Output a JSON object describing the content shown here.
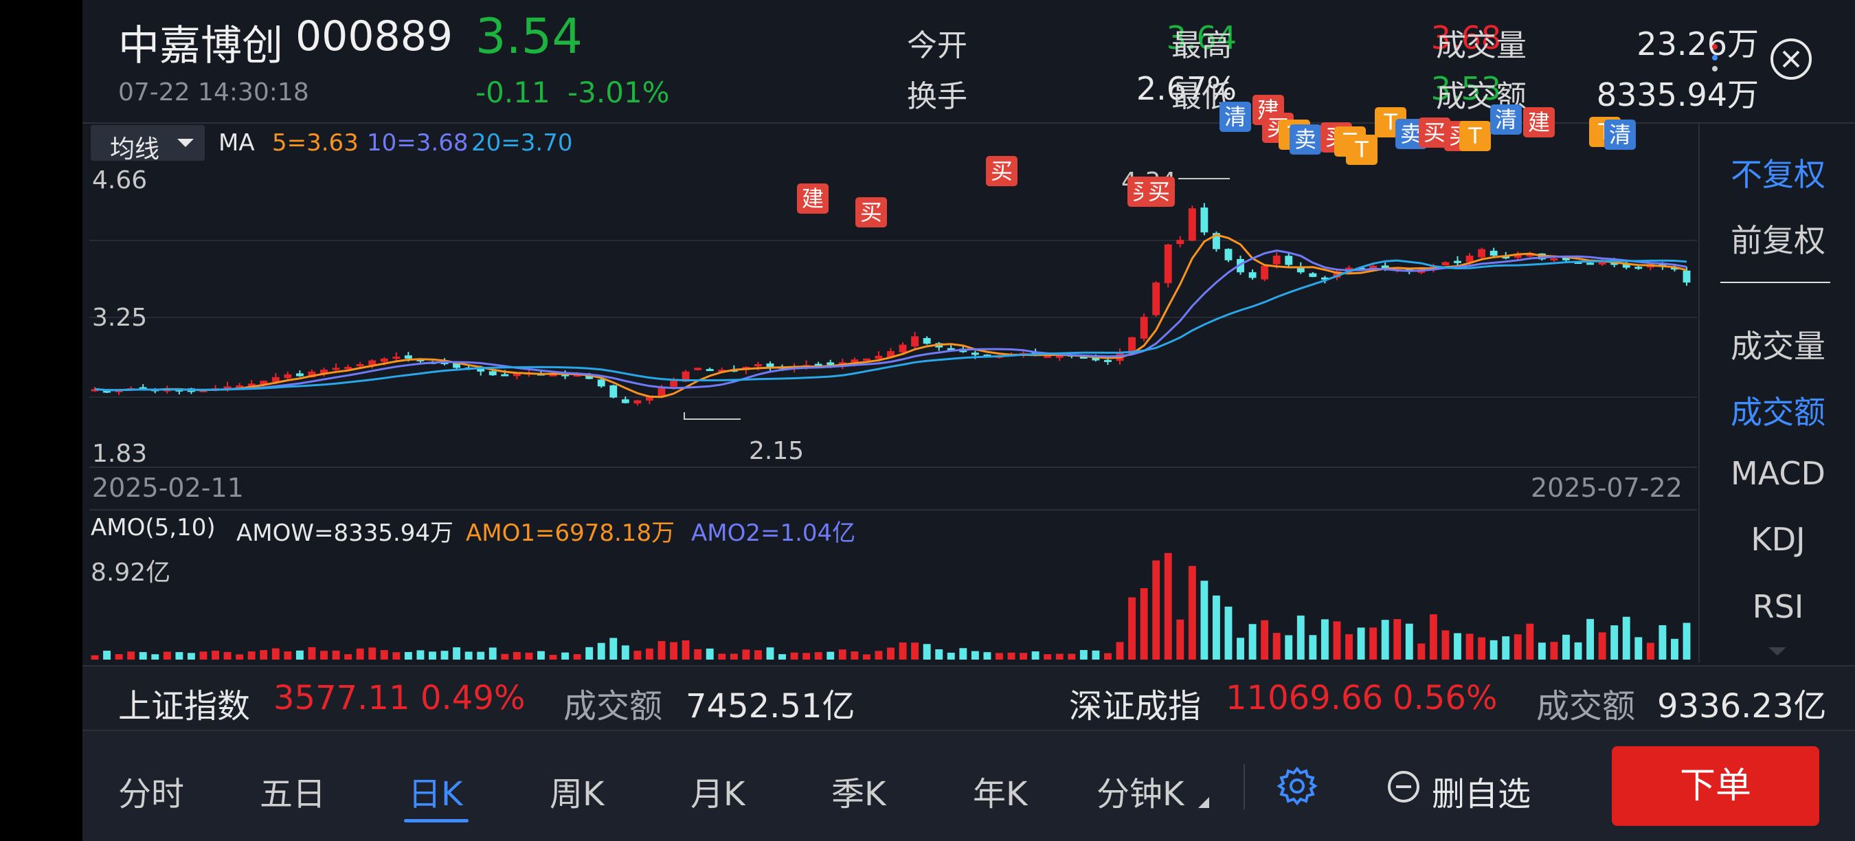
{
  "stock": {
    "name": "中嘉博创",
    "code": "000889",
    "price": "3.54",
    "datetime": "07-22 14:30:18",
    "change": "-0.11",
    "change_pct": "-3.01%"
  },
  "stats": {
    "open_label": "今开",
    "open": "3.64",
    "high_label": "最高",
    "high": "3.68",
    "volume_label": "成交量",
    "volume": "23.26万",
    "turnover_label": "换手",
    "turnover": "2.67%",
    "low_label": "最低",
    "low": "3.53",
    "amount_label": "成交额",
    "amount": "8335.94万"
  },
  "ma_legend": {
    "selector": "均线",
    "prefix": "MA",
    "ma5": "5=3.63",
    "ma10": "10=3.68",
    "ma20": "20=3.70"
  },
  "price_axis": {
    "top": "4.66",
    "mid": "3.25",
    "bottom": "1.83"
  },
  "annotations": {
    "high": "4.34",
    "low": "2.15"
  },
  "dates": {
    "start": "2025-02-11",
    "end": "2025-07-22"
  },
  "amo_legend": {
    "title": "AMO(5,10)",
    "amow": "AMOW=8335.94万",
    "amo1": "AMO1=6978.18万",
    "amo2": "AMO2=1.04亿"
  },
  "amo_axis": {
    "top": "8.92亿"
  },
  "markers": [
    {
      "text": "建",
      "kind": "red"
    },
    {
      "text": "买",
      "kind": "red"
    },
    {
      "text": "买",
      "kind": "red"
    },
    {
      "text": "买",
      "kind": "red"
    },
    {
      "text": "买",
      "kind": "red"
    },
    {
      "text": "清",
      "kind": "blue"
    },
    {
      "text": "建",
      "kind": "red"
    },
    {
      "text": "买",
      "kind": "red"
    },
    {
      "text": "T",
      "kind": "orange"
    },
    {
      "text": "卖",
      "kind": "blue"
    },
    {
      "text": "买",
      "kind": "red"
    },
    {
      "text": "T",
      "kind": "orange"
    },
    {
      "text": "T",
      "kind": "orange"
    },
    {
      "text": "T",
      "kind": "orange"
    },
    {
      "text": "卖",
      "kind": "blue"
    },
    {
      "text": "买",
      "kind": "red"
    },
    {
      "text": "买",
      "kind": "red"
    },
    {
      "text": "T",
      "kind": "orange"
    },
    {
      "text": "清",
      "kind": "blue"
    },
    {
      "text": "建",
      "kind": "red"
    },
    {
      "text": "T",
      "kind": "orange"
    },
    {
      "text": "清",
      "kind": "blue"
    }
  ],
  "right_panel": {
    "items": [
      "不复权",
      "前复权",
      "成交量",
      "成交额",
      "MACD",
      "KDJ",
      "RSI"
    ]
  },
  "index_bar": {
    "sh_name": "上证指数",
    "sh_value": "3577.11",
    "sh_pct": "0.49%",
    "sh_amount_label": "成交额",
    "sh_amount": "7452.51亿",
    "sz_name": "深证成指",
    "sz_value": "11069.66",
    "sz_pct": "0.56%",
    "sz_amount_label": "成交额",
    "sz_amount": "9336.23亿"
  },
  "tabs": [
    "分时",
    "五日",
    "日K",
    "周K",
    "月K",
    "季K",
    "年K",
    "分钟K"
  ],
  "active_tab": "日K",
  "actions": {
    "remove_watch": "删自选",
    "order": "下单"
  },
  "colors": {
    "up": "#e8242b",
    "down": "#1cb33f",
    "accent": "#3f8cff",
    "ma5": "#f7931e",
    "ma10": "#6f7bf7",
    "ma20": "#2aa7e8"
  },
  "chart_data": {
    "type": "candlestick",
    "x_range": [
      "2025-02-11",
      "2025-07-22"
    ],
    "ylim": [
      1.83,
      4.66
    ],
    "close": [
      2.39,
      2.37,
      2.38,
      2.4,
      2.39,
      2.38,
      2.4,
      2.38,
      2.36,
      2.38,
      2.4,
      2.42,
      2.43,
      2.45,
      2.48,
      2.52,
      2.55,
      2.53,
      2.58,
      2.6,
      2.62,
      2.63,
      2.66,
      2.7,
      2.72,
      2.74,
      2.72,
      2.69,
      2.68,
      2.66,
      2.62,
      2.6,
      2.58,
      2.54,
      2.55,
      2.56,
      2.57,
      2.55,
      2.55,
      2.54,
      2.55,
      2.5,
      2.42,
      2.3,
      2.24,
      2.27,
      2.32,
      2.4,
      2.48,
      2.58,
      2.62,
      2.59,
      2.6,
      2.6,
      2.63,
      2.66,
      2.62,
      2.61,
      2.63,
      2.65,
      2.66,
      2.65,
      2.68,
      2.71,
      2.72,
      2.75,
      2.8,
      2.87,
      2.96,
      2.88,
      2.84,
      2.83,
      2.79,
      2.76,
      2.74,
      2.75,
      2.77,
      2.78,
      2.75,
      2.75,
      2.75,
      2.75,
      2.73,
      2.7,
      2.7,
      2.78,
      2.95,
      3.17,
      3.54,
      3.95,
      4.0,
      4.34,
      4.08,
      3.9,
      3.78,
      3.65,
      3.59,
      3.72,
      3.83,
      3.73,
      3.65,
      3.6,
      3.58,
      3.66,
      3.7,
      3.68,
      3.72,
      3.69,
      3.7,
      3.66,
      3.7,
      3.71,
      3.76,
      3.75,
      3.83,
      3.9,
      3.83,
      3.82,
      3.84,
      3.86,
      3.79,
      3.8,
      3.78,
      3.76,
      3.75,
      3.77,
      3.73,
      3.7,
      3.69,
      3.74,
      3.72,
      3.68,
      3.54
    ],
    "amount_ylim": [
      0,
      8.92
    ],
    "amount_unit": "亿"
  }
}
